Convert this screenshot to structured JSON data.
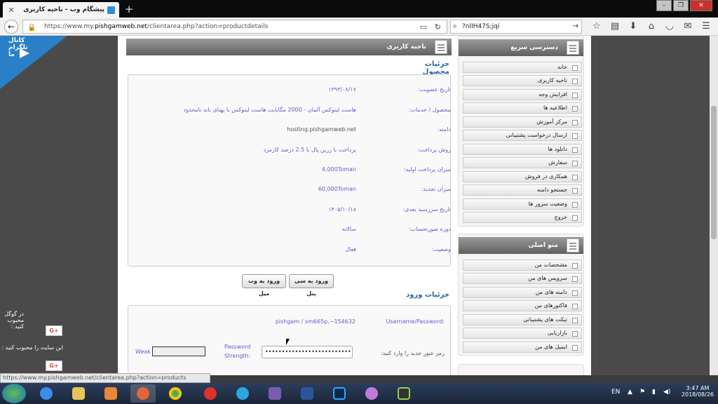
{
  "browser": {
    "tab_title": "پیشگام وب - ناحیه کاربری",
    "url_prefix": "https://www.my.",
    "url_domain": "pishgamweb.net",
    "url_path": "/clientarea.php?action=productdetails",
    "search_text": "?nlIH47S;jqi",
    "status_url": "https://www.my.pishgamweb.net/clientarea.php?action=products"
  },
  "left": {
    "telegram_label": "کانال تلگرام ما",
    "google_like": "در گوگل محبوب کنید :",
    "site_like": "این سایت را محبوب کنید :",
    "gplus": "G+"
  },
  "main": {
    "header": "ناحیه کاربری",
    "product_section": "جزئیات محصول",
    "rows": [
      {
        "label": "تاریخ عضویت:",
        "value": "۱۳۹۳/۰۸/۱۷"
      },
      {
        "label": "محصول / خدمات:",
        "value": "هاست لینوکس آلمان - 2000 مگابایت هاست لینوکس با پهنای باند نامحدود"
      },
      {
        "label": "دامنه:",
        "value": "hosting.pishgamweb.net"
      },
      {
        "label": "روش پرداخت:",
        "value": "پرداخت با زرین پال با 2.5 درصد کارمزد"
      },
      {
        "label": "میزان پرداخت اولیه:",
        "value": "4,000Toman"
      },
      {
        "label": "میزان تجدید:",
        "value": "60,000Toman"
      },
      {
        "label": "تاریخ سررسید بعدی:",
        "value": "۱۴۰۵/۱۰/۱۸"
      },
      {
        "label": "دوره صورتحساب:",
        "value": "سالانه"
      },
      {
        "label": "وضعیت:",
        "value": "فعال"
      }
    ],
    "btn_cpanel": "ورود به سی پنل",
    "btn_webmail": "ورود به وب میل",
    "login_section": "جزئیات ورود",
    "username_label": "Username/Password:",
    "username_value": "pishgam / sm665p,~154632",
    "newpass_label": "رمز عبور جدید را وارد کنید:",
    "password_value": "••••••••••••••••••••••••••••",
    "strength_label_1": "Password",
    "strength_label_2": "Strength:",
    "strength_value": "Weak"
  },
  "sidebar": {
    "quick_title": "دسترسی سریع",
    "quick_items": [
      "خانه",
      "ناحیه کاربری",
      "افزایش وجه",
      "اطلاعیه ها",
      "مرکز آموزش",
      "ارسال درخواست پشتیبانی",
      "دانلود ها",
      "سفارش",
      "همکاری در فروش",
      "جستجو دامنه",
      "وضعیت سرور ها",
      "خروج"
    ],
    "main_title": "منو اصلی",
    "main_items": [
      "مشخصات من",
      "سرویس های من",
      "دامنه های من",
      "فاکتورهای من",
      "تیکت های پشتیبانی",
      "بازاریابی",
      "ایمیل های من"
    ]
  },
  "taskbar": {
    "lang": "EN",
    "time": "3:47 AM",
    "date": "2018/08/26"
  }
}
